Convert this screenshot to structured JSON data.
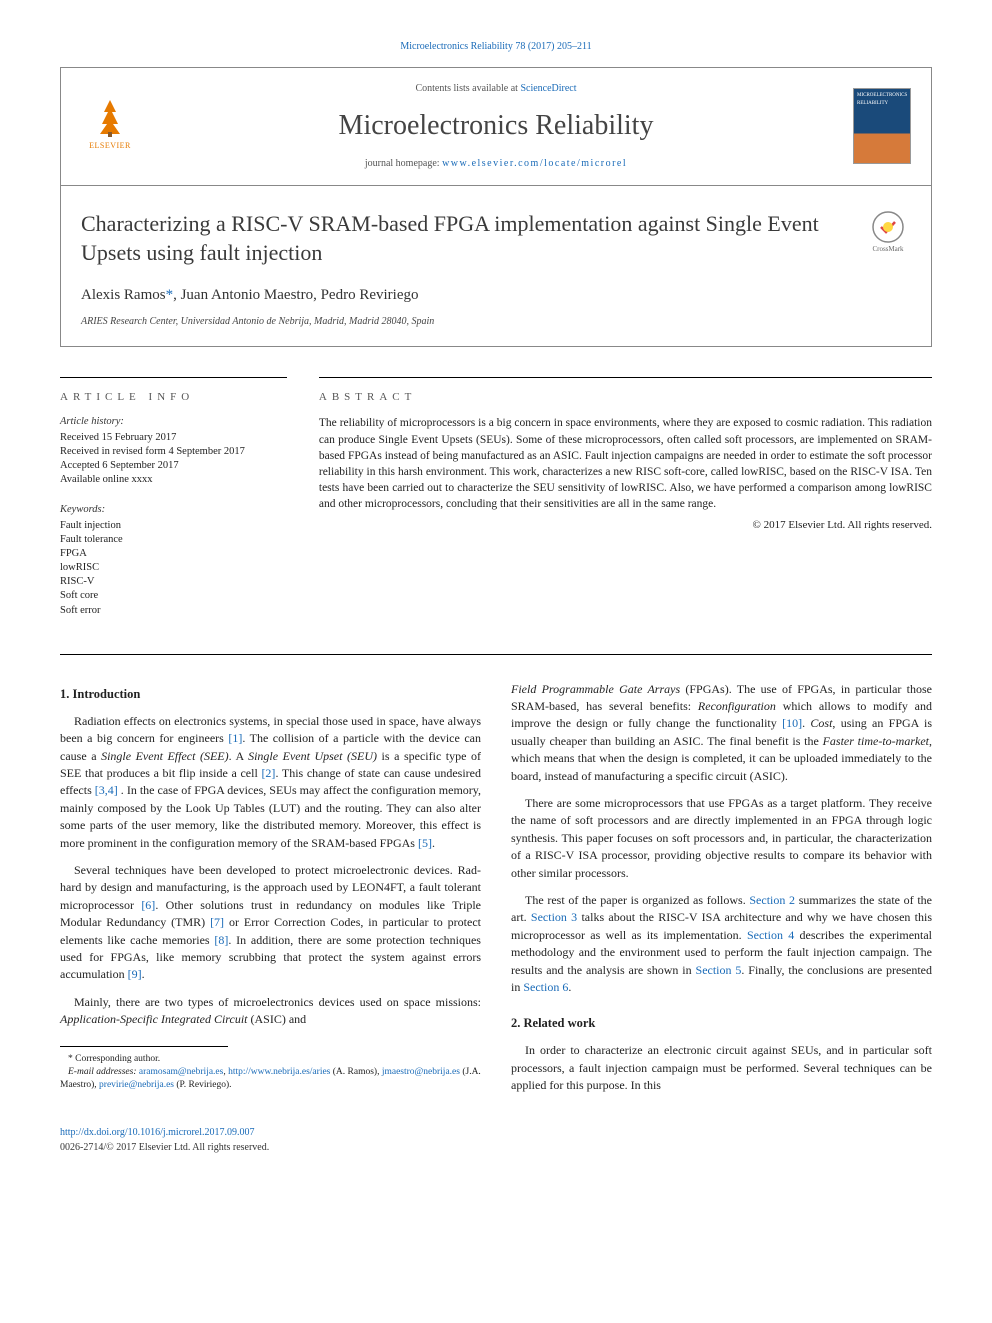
{
  "header_citation": "Microelectronics Reliability 78 (2017) 205–211",
  "contents_line_prefix": "Contents lists available at ",
  "contents_line_link": "ScienceDirect",
  "journal_title": "Microelectronics Reliability",
  "homepage_prefix": "journal homepage: ",
  "homepage_link": "www.elsevier.com/locate/microrel",
  "elsevier_label": "ELSEVIER",
  "cover_text": "MICROELECTRONICS RELIABILITY",
  "crossmark_label": "CrossMark",
  "article_title": "Characterizing a RISC-V SRAM-based FPGA implementation against Single Event Upsets using fault injection",
  "authors_line_prefix": "Alexis Ramos",
  "authors_star": "*",
  "authors_line_rest": ", Juan Antonio Maestro, Pedro Reviriego",
  "affiliation": "ARIES Research Center, Universidad Antonio de Nebrija, Madrid, Madrid 28040, Spain",
  "article_info_heading": "ARTICLE INFO",
  "article_history_label": "Article history:",
  "history_received": "Received 15 February 2017",
  "history_revised": "Received in revised form 4 September 2017",
  "history_accepted": "Accepted 6 September 2017",
  "history_online": "Available online xxxx",
  "keywords_label": "Keywords:",
  "keywords": [
    "Fault injection",
    "Fault tolerance",
    "FPGA",
    "lowRISC",
    "RISC-V",
    "Soft core",
    "Soft error"
  ],
  "abstract_heading": "ABSTRACT",
  "abstract_text": "The reliability of microprocessors is a big concern in space environments, where they are exposed to cosmic radiation. This radiation can produce Single Event Upsets (SEUs). Some of these microprocessors, often called soft processors, are implemented on SRAM-based FPGAs instead of being manufactured as an ASIC. Fault injection campaigns are needed in order to estimate the soft processor reliability in this harsh environment. This work, characterizes a new RISC soft-core, called lowRISC, based on the RISC-V ISA. Ten tests have been carried out to characterize the SEU sensitivity of lowRISC. Also, we have performed a comparison among lowRISC and other microprocessors, concluding that their sensitivities are all in the same range.",
  "abstract_copyright": "© 2017 Elsevier Ltd. All rights reserved.",
  "sections": {
    "intro_heading": "1. Introduction",
    "intro_p1_a": "Radiation effects on electronics systems, in special those used in space, have always been a big concern for engineers ",
    "intro_p1_ref1": "[1]",
    "intro_p1_b": ". The collision of a particle with the device can cause a ",
    "intro_p1_em1": "Single Event Effect (SEE)",
    "intro_p1_c": ". A ",
    "intro_p1_em2": "Single Event Upset (SEU)",
    "intro_p1_d": " is a specific type of SEE that produces a bit flip inside a cell ",
    "intro_p1_ref2": "[2]",
    "intro_p1_e": ". This change of state can cause undesired effects ",
    "intro_p1_ref34": "[3,4]",
    "intro_p1_f": " . In the case of FPGA devices, SEUs may affect the configuration memory, mainly composed by the Look Up Tables (LUT) and the routing. They can also alter some parts of the user memory, like the distributed memory. Moreover, this effect is more prominent in the configuration memory of the SRAM-based FPGAs ",
    "intro_p1_ref5": "[5]",
    "intro_p1_g": ".",
    "intro_p2_a": "Several techniques have been developed to protect microelectronic devices. Rad-hard by design and manufacturing, is the approach used by LEON4FT, a fault tolerant microprocessor ",
    "intro_p2_ref6": "[6]",
    "intro_p2_b": ". Other solutions trust in redundancy on modules like Triple Modular Redundancy (TMR) ",
    "intro_p2_ref7": "[7]",
    "intro_p2_c": " or Error Correction Codes, in particular to protect elements like cache memories ",
    "intro_p2_ref8": "[8]",
    "intro_p2_d": ". In addition, there are some protection techniques used for FPGAs, like memory scrubbing that protect the system against errors accumulation ",
    "intro_p2_ref9": "[9]",
    "intro_p2_e": ".",
    "intro_p3_a": "Mainly, there are two types of microelectronics devices used on space missions: ",
    "intro_p3_em1": "Application-Specific Integrated Circuit",
    "intro_p3_b": " (ASIC) and ",
    "intro_p3_em2": "Field Programmable Gate Arrays",
    "intro_p3_c": " (FPGAs). The use of FPGAs, in particular those SRAM-based, has several benefits: ",
    "intro_p3_em3": "Reconfiguration",
    "intro_p3_d": " which allows to modify and improve the design or fully change the functionality ",
    "intro_p3_ref10": "[10]",
    "intro_p3_e": ". ",
    "intro_p3_em4": "Cost",
    "intro_p3_f": ", using an FPGA is usually cheaper than building an ASIC. The final benefit is the ",
    "intro_p3_em5": "Faster time-to-market",
    "intro_p3_g": ", which means that when the design is completed, it can be uploaded immediately to the board, instead of manufacturing a specific circuit (ASIC).",
    "intro_p4": "There are some microprocessors that use FPGAs as a target platform. They receive the name of soft processors and are directly implemented in an FPGA through logic synthesis. This paper focuses on soft processors and, in particular, the characterization of a RISC-V ISA processor, providing objective results to compare its behavior with other similar processors.",
    "intro_p5_a": "The rest of the paper is organized as follows. ",
    "intro_p5_s2": "Section 2",
    "intro_p5_b": " summarizes the state of the art. ",
    "intro_p5_s3": "Section 3",
    "intro_p5_c": " talks about the RISC-V ISA architecture and why we have chosen this microprocessor as well as its implementation. ",
    "intro_p5_s4": "Section 4",
    "intro_p5_d": " describes the experimental methodology and the environment used to perform the fault injection campaign. The results and the analysis are shown in ",
    "intro_p5_s5": "Section 5",
    "intro_p5_e": ". Finally, the conclusions are presented in ",
    "intro_p5_s6": "Section 6",
    "intro_p5_f": ".",
    "related_heading": "2. Related work",
    "related_p1": "In order to characterize an electronic circuit against SEUs, and in particular soft processors, a fault injection campaign must be performed. Several techniques can be applied for this purpose. In this"
  },
  "footnotes": {
    "corresponding": "* Corresponding author.",
    "emails_label": "E-mail addresses: ",
    "email1": "aramosam@nebrija.es",
    "email1_sep": ", ",
    "aries_url": "http://www.nebrija.es/aries",
    "name1": " (A. Ramos), ",
    "email2": "jmaestro@nebrija.es",
    "name2": " (J.A. Maestro), ",
    "email3": "previrie@nebrija.es",
    "name3": " (P. Reviriego)."
  },
  "footer": {
    "doi": "http://dx.doi.org/10.1016/j.microrel.2017.09.007",
    "issn_line": "0026-2714/© 2017 Elsevier Ltd. All rights reserved."
  }
}
